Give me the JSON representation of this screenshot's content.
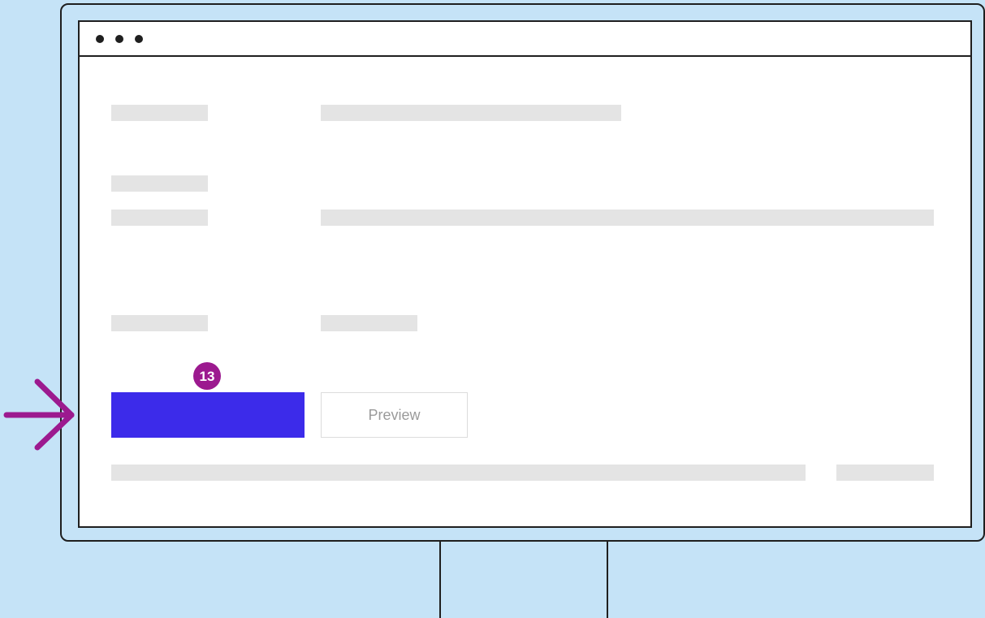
{
  "form": {
    "preview_label": "Preview"
  },
  "annotation": {
    "step_number": "13"
  },
  "colors": {
    "background": "#c5e3f7",
    "primary_button": "#3c2bea",
    "step_badge": "#9c1a8f",
    "placeholder_bar": "#e4e4e4",
    "outline": "#1f1f1f"
  },
  "icons": {
    "pointer": "arrow-right-icon",
    "window_controls": "window-dots-icon"
  }
}
